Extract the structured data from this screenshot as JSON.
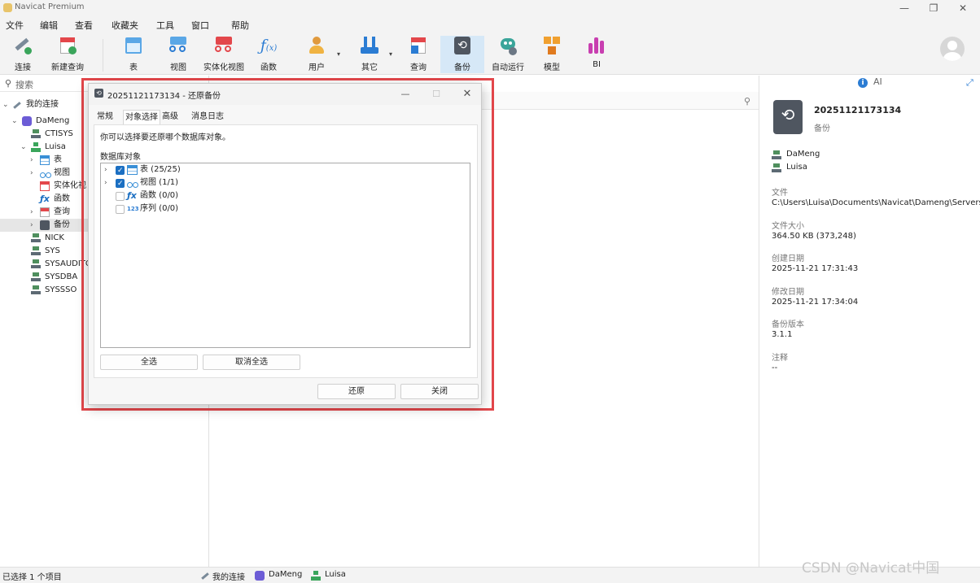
{
  "window": {
    "title": "Navicat Premium",
    "controls": [
      "—",
      "❐",
      "✕"
    ]
  },
  "menu": [
    "文件",
    "编辑",
    "查看",
    "收藏夹",
    "工具",
    "窗口",
    "帮助"
  ],
  "toolbar": {
    "buttons": [
      {
        "label": "连接",
        "icon": "connection-icon"
      },
      {
        "label": "新建查询",
        "icon": "new-query-icon"
      },
      {
        "label": "表",
        "icon": "table-icon"
      },
      {
        "label": "视图",
        "icon": "view-icon"
      },
      {
        "label": "实体化视图",
        "icon": "materialized-view-icon"
      },
      {
        "label": "函数",
        "icon": "function-icon"
      },
      {
        "label": "用户",
        "icon": "user-icon"
      },
      {
        "label": "其它",
        "icon": "tools-icon"
      },
      {
        "label": "查询",
        "icon": "query-icon"
      },
      {
        "label": "备份",
        "icon": "backup-icon"
      },
      {
        "label": "自动运行",
        "icon": "robot-icon"
      },
      {
        "label": "模型",
        "icon": "model-icon"
      },
      {
        "label": "BI",
        "icon": "bi-icon"
      }
    ],
    "active": "备份"
  },
  "sidebar": {
    "search_placeholder": "搜索",
    "tree": [
      {
        "label": "我的连接",
        "level": 0,
        "icon": "connection-icon"
      },
      {
        "label": "DaMeng",
        "level": 1,
        "icon": "database-icon"
      },
      {
        "label": "CTISYS",
        "level": 2,
        "icon": "schema-icon"
      },
      {
        "label": "Luisa",
        "level": 2,
        "icon": "schema-icon"
      },
      {
        "label": "表",
        "level": 3,
        "icon": "table-icon"
      },
      {
        "label": "视图",
        "level": 3,
        "icon": "view-icon"
      },
      {
        "label": "实体化视",
        "level": 3,
        "icon": "materialized-view-icon"
      },
      {
        "label": "函数",
        "level": 3,
        "icon": "function-icon"
      },
      {
        "label": "查询",
        "level": 3,
        "icon": "query-icon"
      },
      {
        "label": "备份",
        "level": 3,
        "icon": "backup-icon"
      },
      {
        "label": "NICK",
        "level": 2,
        "icon": "schema-icon"
      },
      {
        "label": "SYS",
        "level": 2,
        "icon": "schema-icon"
      },
      {
        "label": "SYSAUDITO",
        "level": 2,
        "icon": "schema-icon"
      },
      {
        "label": "SYSDBA",
        "level": 2,
        "icon": "schema-icon"
      },
      {
        "label": "SYSSSO",
        "level": 2,
        "icon": "schema-icon"
      }
    ],
    "selected": "备份"
  },
  "dialog": {
    "title": "20251121173134 - 还原备份",
    "tabs": [
      "常规",
      "对象选择",
      "高级",
      "消息日志"
    ],
    "active_tab": "对象选择",
    "description": "你可以选择要还原哪个数据库对象。",
    "objects_label": "数据库对象",
    "objects": [
      {
        "label": "表 (25/25)",
        "checked": true,
        "expandable": true,
        "icon": "table-icon"
      },
      {
        "label": "视图 (1/1)",
        "checked": true,
        "expandable": true,
        "icon": "view-icon"
      },
      {
        "label": "函数 (0/0)",
        "checked": false,
        "expandable": false,
        "icon": "function-icon"
      },
      {
        "label": "序列 (0/0)",
        "checked": false,
        "expandable": false,
        "icon": "sequence-icon"
      }
    ],
    "select_all": "全选",
    "deselect_all": "取消全选",
    "restore": "还原",
    "close": "关闭"
  },
  "details": {
    "ai_label": "AI",
    "name": "20251121173134",
    "type": "备份",
    "connection": "DaMeng",
    "schema": "Luisa",
    "fields": [
      {
        "label": "文件",
        "value": "C:\\Users\\Luisa\\Documents\\Navicat\\Dameng\\Servers\\Da"
      },
      {
        "label": "文件大小",
        "value": "364.50 KB (373,248)"
      },
      {
        "label": "创建日期",
        "value": "2025-11-21 17:31:43"
      },
      {
        "label": "修改日期",
        "value": "2025-11-21 17:34:04"
      },
      {
        "label": "备份版本",
        "value": "3.1.1"
      },
      {
        "label": "注释",
        "value": "--"
      }
    ]
  },
  "statusbar": {
    "left": "已选择 1 个项目",
    "crumbs": [
      "我的连接",
      "DaMeng",
      "Luisa"
    ]
  },
  "watermark": "CSDN @Navicat中国"
}
